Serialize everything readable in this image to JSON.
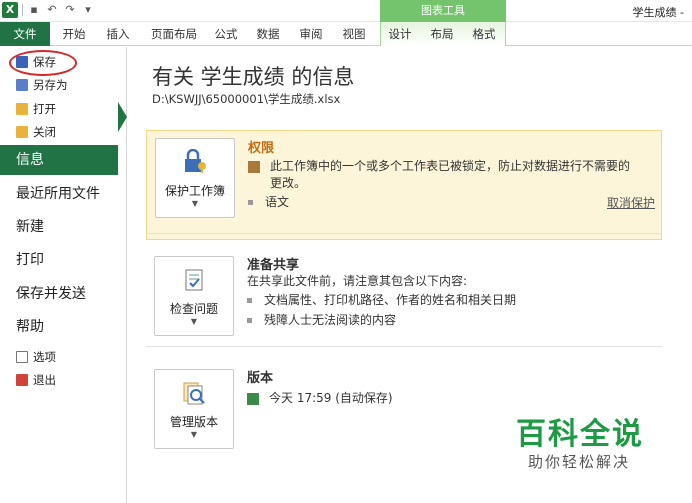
{
  "window": {
    "title": "学生成绩 -"
  },
  "ribbon": {
    "context_group": "图表工具",
    "tabs": [
      "文件",
      "开始",
      "插入",
      "页面布局",
      "公式",
      "数据",
      "审阅",
      "视图",
      "设计",
      "布局",
      "格式"
    ]
  },
  "nav": {
    "save": "保存",
    "save_as": "另存为",
    "open": "打开",
    "close": "关闭",
    "info": "信息",
    "recent": "最近所用文件",
    "new": "新建",
    "print": "打印",
    "save_send": "保存并发送",
    "help": "帮助",
    "options": "选项",
    "exit": "退出"
  },
  "info": {
    "title": "有关 学生成绩 的信息",
    "path": "D:\\KSWJJ\\65000001\\学生成绩.xlsx"
  },
  "permissions": {
    "button": "保护工作簿",
    "title": "权限",
    "line1": "此工作簿中的一个或多个工作表已被锁定，防止对数据进行不需要的",
    "line2": "更改。",
    "item": "语文",
    "link": "取消保护"
  },
  "share": {
    "button": "检查问题",
    "title": "准备共享",
    "desc": "在共享此文件前，请注意其包含以下内容:",
    "items": [
      "文档属性、打印机路径、作者的姓名和相关日期",
      "残障人士无法阅读的内容"
    ]
  },
  "versions": {
    "button": "管理版本",
    "title": "版本",
    "entry": "今天 17:59 (自动保存)"
  },
  "watermark": {
    "brand": "百科全说",
    "slogan": "助你轻松解决"
  },
  "colors": {
    "accent": "#217346",
    "context": "#74c46e",
    "warning_bg": "#fdf5d9",
    "highlight": "#d6282b"
  }
}
